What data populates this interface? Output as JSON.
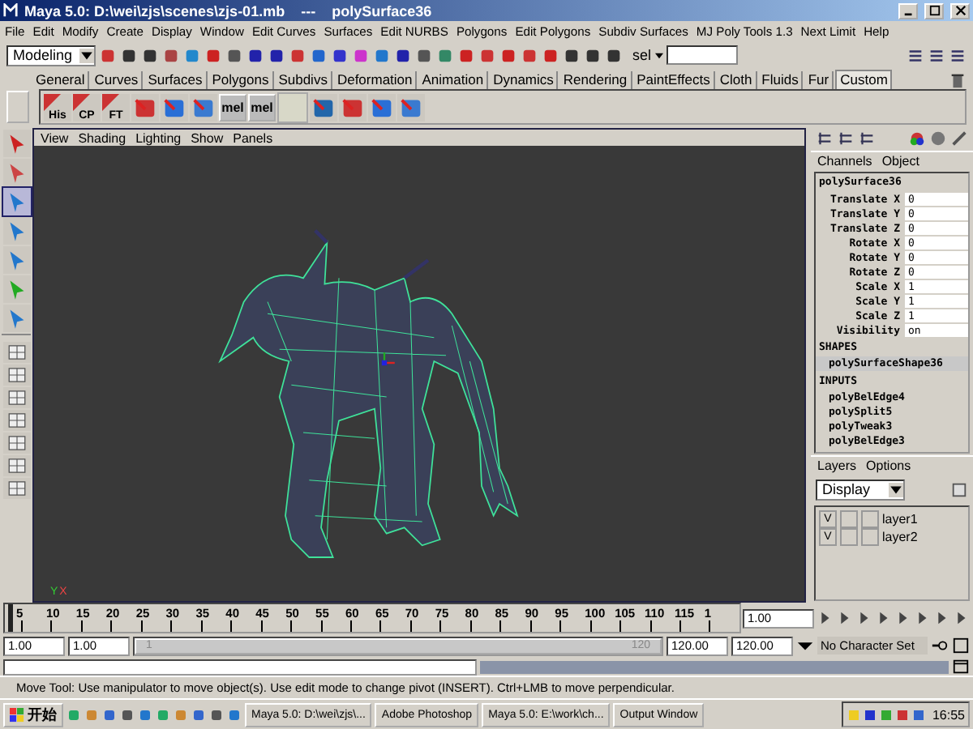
{
  "window": {
    "title": "Maya 5.0: D:\\wei\\zjs\\scenes\\zjs-01.mb",
    "separator": "---",
    "object": "polySurface36"
  },
  "menu": [
    "File",
    "Edit",
    "Modify",
    "Create",
    "Display",
    "Window",
    "Edit Curves",
    "Surfaces",
    "Edit NURBS",
    "Polygons",
    "Edit Polygons",
    "Subdiv Surfaces",
    "MJ Poly Tools 1.3",
    "Next Limit",
    "Help"
  ],
  "status_line": {
    "mode": "Modeling",
    "sel_label": "sel"
  },
  "shelf_tabs": [
    {
      "label": "General",
      "selected": false
    },
    {
      "label": "Curves",
      "selected": false
    },
    {
      "label": "Surfaces",
      "selected": false
    },
    {
      "label": "Polygons",
      "selected": false
    },
    {
      "label": "Subdivs",
      "selected": false
    },
    {
      "label": "Deformation",
      "selected": false
    },
    {
      "label": "Animation",
      "selected": false
    },
    {
      "label": "Dynamics",
      "selected": false
    },
    {
      "label": "Rendering",
      "selected": false
    },
    {
      "label": "PaintEffects",
      "selected": false
    },
    {
      "label": "Cloth",
      "selected": false
    },
    {
      "label": "Fluids",
      "selected": false
    },
    {
      "label": "Fur",
      "selected": false
    },
    {
      "label": "Custom",
      "selected": true
    }
  ],
  "shelf_items": [
    {
      "kind": "label",
      "text": "His"
    },
    {
      "kind": "label",
      "text": "CP"
    },
    {
      "kind": "label",
      "text": "FT"
    },
    {
      "kind": "icon"
    },
    {
      "kind": "icon"
    },
    {
      "kind": "icon"
    },
    {
      "kind": "mel",
      "text": "mel"
    },
    {
      "kind": "mel",
      "text": "mel"
    },
    {
      "kind": "blank"
    },
    {
      "kind": "icon"
    },
    {
      "kind": "icon"
    },
    {
      "kind": "icon"
    },
    {
      "kind": "icon"
    }
  ],
  "tools": [
    {
      "selected": false
    },
    {
      "selected": false
    },
    {
      "selected": true
    },
    {
      "selected": false
    },
    {
      "selected": false
    },
    {
      "selected": false
    },
    {
      "selected": false
    }
  ],
  "viewport": {
    "menu": [
      "View",
      "Shading",
      "Lighting",
      "Show",
      "Panels"
    ],
    "axis_y": "Y",
    "axis_x": "X"
  },
  "channel_box": {
    "tabs": [
      "Channels",
      "Object"
    ],
    "node": "polySurface36",
    "attributes": [
      {
        "name": "Translate X",
        "value": "0"
      },
      {
        "name": "Translate Y",
        "value": "0"
      },
      {
        "name": "Translate Z",
        "value": "0"
      },
      {
        "name": "Rotate X",
        "value": "0"
      },
      {
        "name": "Rotate Y",
        "value": "0"
      },
      {
        "name": "Rotate Z",
        "value": "0"
      },
      {
        "name": "Scale X",
        "value": "1"
      },
      {
        "name": "Scale Y",
        "value": "1"
      },
      {
        "name": "Scale Z",
        "value": "1"
      },
      {
        "name": "Visibility",
        "value": "on"
      }
    ],
    "shapes_heading": "SHAPES",
    "shape": "polySurfaceShape36",
    "inputs_heading": "INPUTS",
    "inputs": [
      "polyBelEdge4",
      "polySplit5",
      "polyTweak3",
      "polyBelEdge3"
    ]
  },
  "layers": {
    "tabs": [
      "Layers",
      "Options"
    ],
    "mode": "Display",
    "items": [
      {
        "visible": "V",
        "name": "layer1"
      },
      {
        "visible": "V",
        "name": "layer2"
      }
    ]
  },
  "timeline": {
    "ticks": [
      "5",
      "10",
      "15",
      "20",
      "25",
      "30",
      "35",
      "40",
      "45",
      "50",
      "55",
      "60",
      "65",
      "70",
      "75",
      "80",
      "85",
      "90",
      "95",
      "100",
      "105",
      "110",
      "115",
      "1"
    ],
    "current": "1.00",
    "level": 0
  },
  "range": {
    "start": "1.00",
    "play_start": "1.00",
    "slider_start": "1",
    "slider_end": "120",
    "play_end": "120.00",
    "end": "120.00",
    "character_set": "No Character Set",
    "level": 1
  },
  "help_line": "Move Tool: Use manipulator to move object(s). Use edit mode to change pivot (INSERT).  Ctrl+LMB to move perpendicular.",
  "taskbar": {
    "start": "开始",
    "tasks": [
      "Maya 5.0: D:\\wei\\zjs\\...",
      "Adobe Photoshop",
      "Maya 5.0: E:\\work\\ch...",
      "Output Window"
    ],
    "clock": "16:55"
  }
}
